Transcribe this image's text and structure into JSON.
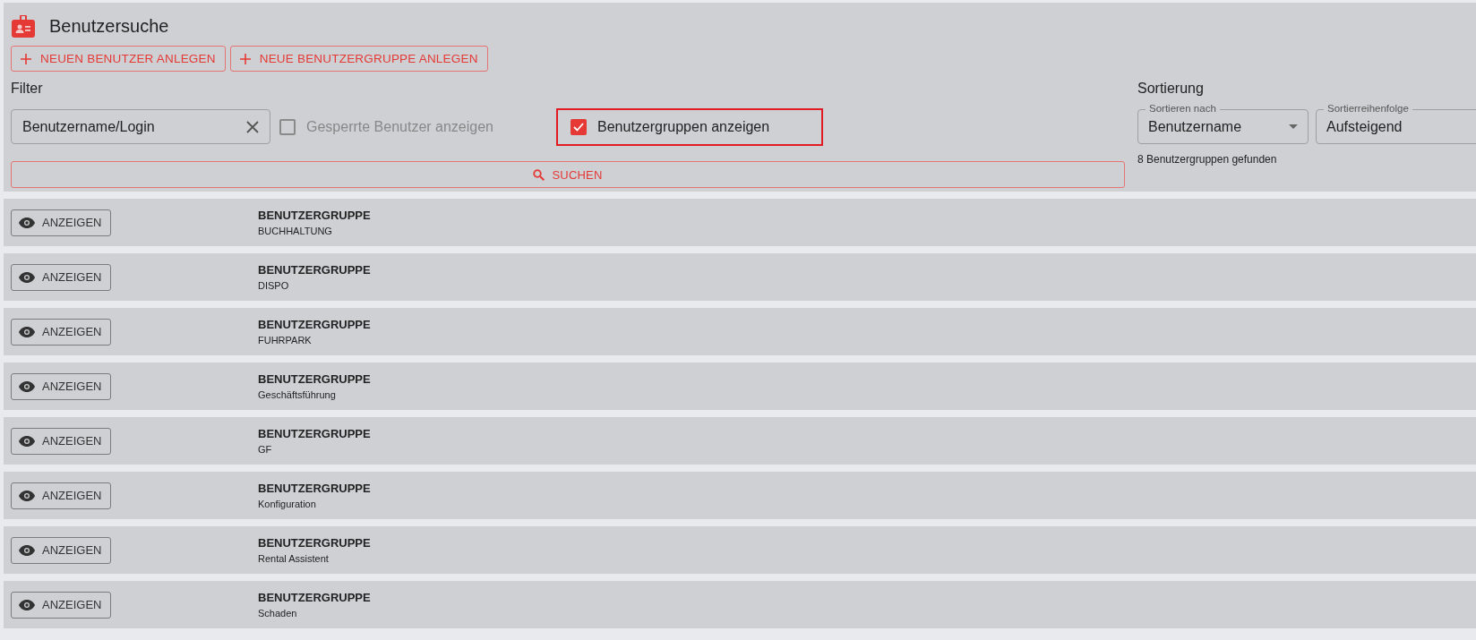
{
  "header": {
    "title": "Benutzersuche"
  },
  "actions": [
    {
      "label": "NEUEN BENUTZER ANLEGEN"
    },
    {
      "label": "NEUE BENUTZERGRUPPE ANLEGEN"
    }
  ],
  "filter": {
    "heading": "Filter",
    "search": {
      "value": "Benutzername/Login"
    },
    "checkboxes": [
      {
        "label": "Gesperrte Benutzer anzeigen",
        "checked": false,
        "highlighted": false
      },
      {
        "label": "Benutzergruppen anzeigen",
        "checked": true,
        "highlighted": true
      }
    ],
    "search_button": "SUCHEN"
  },
  "sorting": {
    "heading": "Sortierung",
    "selects": [
      {
        "label": "Sortieren nach",
        "value": "Benutzername",
        "dropdown": true
      },
      {
        "label": "Sortierreihenfolge",
        "value": "Aufsteigend"
      }
    ],
    "result_count": "8 Benutzergruppen gefunden"
  },
  "results": [
    {
      "button": "ANZEIGEN",
      "type": "BENUTZERGRUPPE",
      "name": "BUCHHALTUNG"
    },
    {
      "button": "ANZEIGEN",
      "type": "BENUTZERGRUPPE",
      "name": "DISPO"
    },
    {
      "button": "ANZEIGEN",
      "type": "BENUTZERGRUPPE",
      "name": "FUHRPARK"
    },
    {
      "button": "ANZEIGEN",
      "type": "BENUTZERGRUPPE",
      "name": "Geschäftsführung"
    },
    {
      "button": "ANZEIGEN",
      "type": "BENUTZERGRUPPE",
      "name": "GF"
    },
    {
      "button": "ANZEIGEN",
      "type": "BENUTZERGRUPPE",
      "name": "Konfiguration"
    },
    {
      "button": "ANZEIGEN",
      "type": "BENUTZERGRUPPE",
      "name": "Rental Assistent"
    },
    {
      "button": "ANZEIGEN",
      "type": "BENUTZERGRUPPE",
      "name": "Schaden"
    }
  ]
}
